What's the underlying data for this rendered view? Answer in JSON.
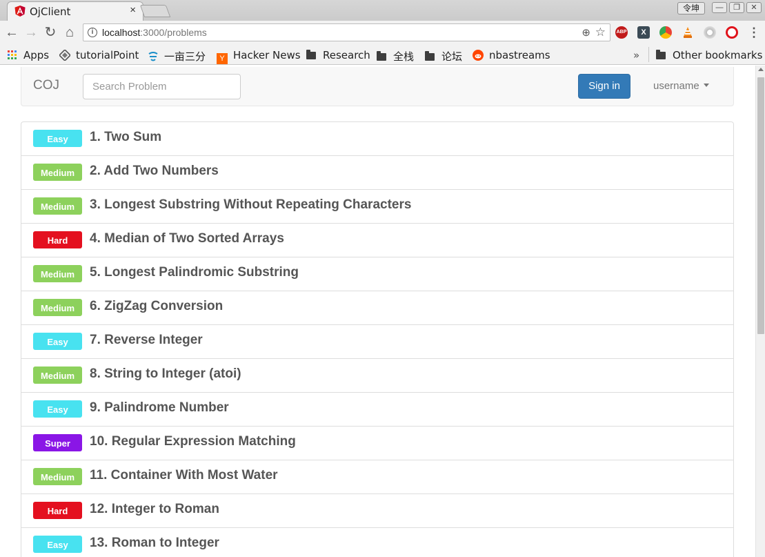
{
  "browser": {
    "tab_title": "OjClient",
    "tab_close": "×",
    "ime_label": "令坤",
    "window_buttons": [
      "—",
      "❐",
      "✕"
    ],
    "url_host": "localhost",
    "url_path": ":3000/problems",
    "bookmarks": [
      {
        "label": "Apps",
        "icon": "apps-grid-icon"
      },
      {
        "label": "tutorialPoint",
        "icon": "tutorialpoint-icon"
      },
      {
        "label": "一亩三分",
        "icon": "site-icon"
      },
      {
        "label": "Hacker News",
        "icon": "hackernews-icon"
      },
      {
        "label": "Research",
        "icon": "folder-icon"
      },
      {
        "label": "全栈",
        "icon": "folder-icon"
      },
      {
        "label": "论坛",
        "icon": "folder-icon"
      },
      {
        "label": "nbastreams",
        "icon": "reddit-icon"
      }
    ],
    "bookmarks_overflow": "»",
    "other_bookmarks": "Other bookmarks"
  },
  "navbar": {
    "brand": "COJ",
    "search_placeholder": "Search Problem",
    "signin_label": "Sign in",
    "username": "username"
  },
  "difficulty_colors": {
    "Easy": "#48e2f0",
    "Medium": "#8dd15c",
    "Hard": "#e4101f",
    "Super": "#8a16e6"
  },
  "problems": [
    {
      "difficulty": "Easy",
      "title": "1. Two Sum"
    },
    {
      "difficulty": "Medium",
      "title": "2. Add Two Numbers"
    },
    {
      "difficulty": "Medium",
      "title": "3. Longest Substring Without Repeating Characters"
    },
    {
      "difficulty": "Hard",
      "title": "4. Median of Two Sorted Arrays"
    },
    {
      "difficulty": "Medium",
      "title": "5. Longest Palindromic Substring"
    },
    {
      "difficulty": "Medium",
      "title": "6. ZigZag Conversion"
    },
    {
      "difficulty": "Easy",
      "title": "7. Reverse Integer"
    },
    {
      "difficulty": "Medium",
      "title": "8. String to Integer (atoi)"
    },
    {
      "difficulty": "Easy",
      "title": "9. Palindrome Number"
    },
    {
      "difficulty": "Super",
      "title": "10. Regular Expression Matching"
    },
    {
      "difficulty": "Medium",
      "title": "11. Container With Most Water"
    },
    {
      "difficulty": "Hard",
      "title": "12. Integer to Roman"
    },
    {
      "difficulty": "Easy",
      "title": "13. Roman to Integer"
    }
  ]
}
